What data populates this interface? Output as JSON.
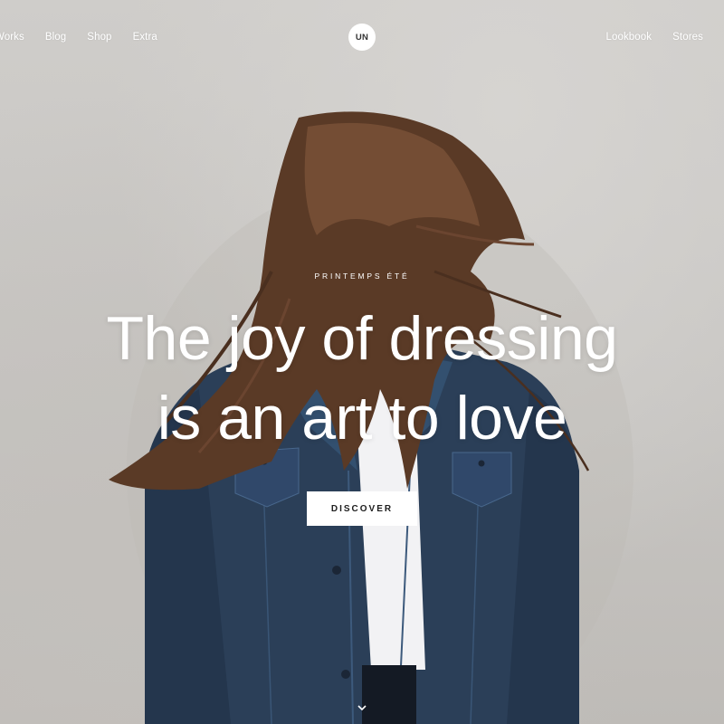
{
  "nav": {
    "left": [
      "Works",
      "Blog",
      "Shop",
      "Extra"
    ],
    "logo": "UN",
    "right": [
      "Lookbook",
      "Stores"
    ]
  },
  "hero": {
    "eyebrow": "PRINTEMPS ÉTÉ",
    "headline_line1": "The joy of dressing",
    "headline_line2": "is an art to love",
    "cta_label": "DISCOVER"
  },
  "colors": {
    "text": "#ffffff",
    "button_bg": "#ffffff",
    "button_text": "#1d1d1d",
    "wall": "#c9c7c4",
    "denim": "#2b3f58",
    "hair": "#5a3a26"
  },
  "icons": {
    "scroll": "chevron-down-icon"
  }
}
